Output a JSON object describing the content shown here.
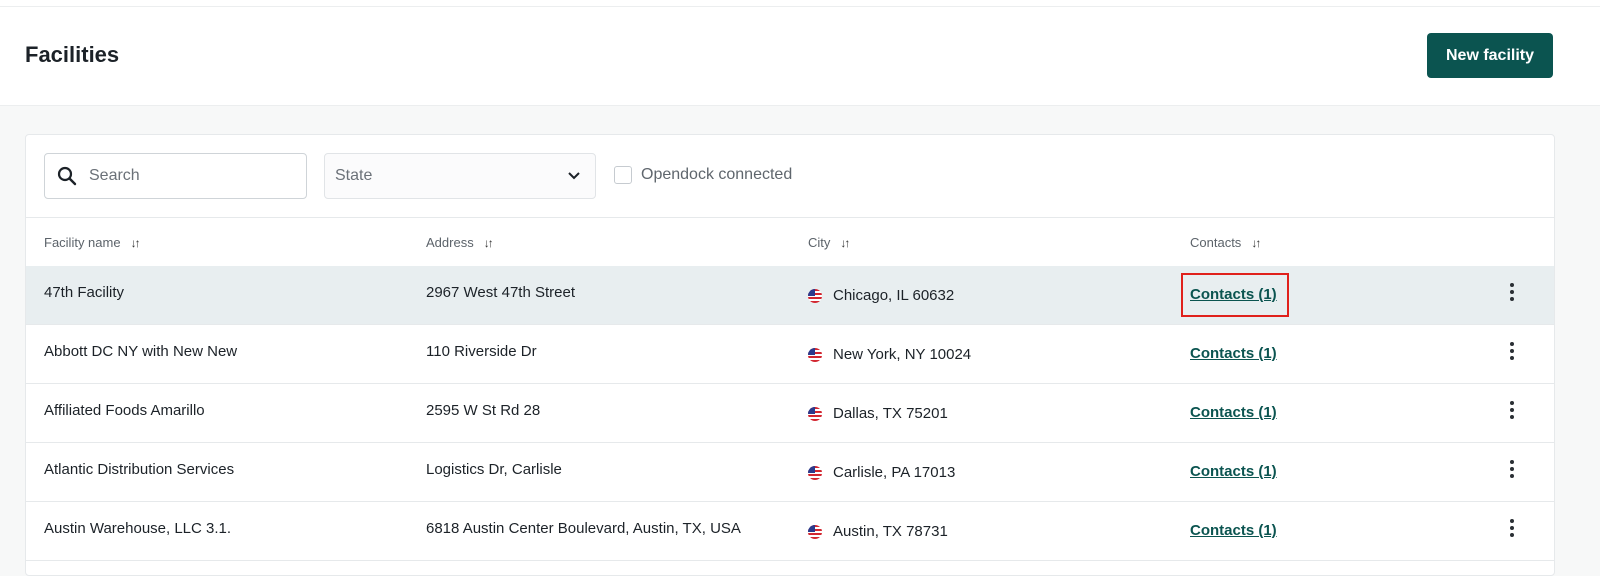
{
  "header": {
    "title": "Facilities",
    "new_button_label": "New facility"
  },
  "filters": {
    "search_placeholder": "Search",
    "state_placeholder": "State",
    "opendock_label": "Opendock connected"
  },
  "table": {
    "columns": [
      "Facility name",
      "Address",
      "City",
      "Contacts"
    ],
    "rows": [
      {
        "name": "47th Facility",
        "address": "2967 West 47th Street",
        "city": "Chicago, IL 60632",
        "contacts": "Contacts (1)"
      },
      {
        "name": "Abbott DC NY with New New",
        "address": "110 Riverside Dr",
        "city": "New York, NY 10024",
        "contacts": "Contacts (1)"
      },
      {
        "name": "Affiliated Foods Amarillo",
        "address": "2595 W St Rd 28",
        "city": "Dallas, TX 75201",
        "contacts": "Contacts (1)"
      },
      {
        "name": "Atlantic Distribution Services",
        "address": "Logistics Dr, Carlisle",
        "city": "Carlisle, PA 17013",
        "contacts": "Contacts (1)"
      },
      {
        "name": "Austin Warehouse, LLC 3.1.",
        "address": "6818 Austin Center Boulevard, Austin, TX, USA",
        "city": "Austin, TX 78731",
        "contacts": "Contacts (1)"
      }
    ]
  },
  "icons": {
    "search": "search-icon",
    "chevron": "chevron-down-icon",
    "sort": "sort-icon",
    "flag": "us-flag-icon",
    "more": "more-vertical-icon"
  },
  "colors": {
    "accent": "#0b5450",
    "highlight": "#e0201b",
    "selected_row": "#e8eef0"
  }
}
